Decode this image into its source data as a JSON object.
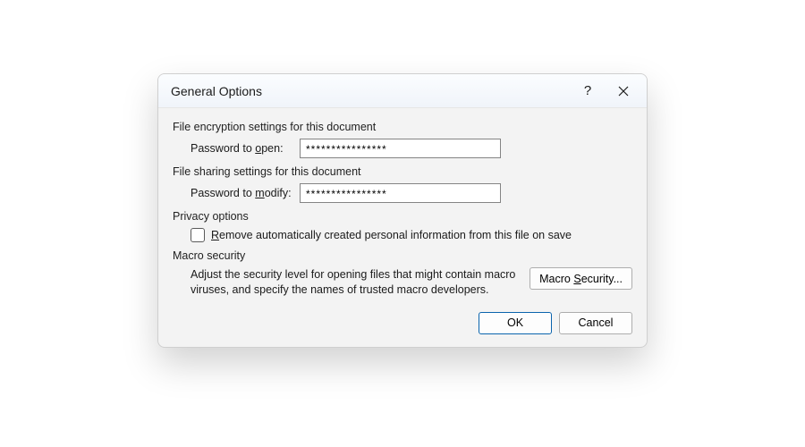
{
  "titlebar": {
    "title": "General Options",
    "help_symbol": "?"
  },
  "encryption": {
    "group_label": "File encryption settings for this document",
    "password_open_prefix": "Password to ",
    "password_open_key": "o",
    "password_open_suffix": "pen:",
    "password_open_value": "****************"
  },
  "sharing": {
    "group_label": "File sharing settings for this document",
    "password_modify_prefix": "Password to ",
    "password_modify_key": "m",
    "password_modify_suffix": "odify:",
    "password_modify_value": "****************"
  },
  "privacy": {
    "group_label": "Privacy options",
    "checkbox_checked": false,
    "label_key": "R",
    "label_rest": "emove automatically created personal information from this file on save"
  },
  "macro": {
    "group_label": "Macro security",
    "description": "Adjust the security level for opening files that might contain macro viruses, and specify the names of trusted macro developers.",
    "button_prefix": "Macro ",
    "button_key": "S",
    "button_suffix": "ecurity..."
  },
  "footer": {
    "ok": "OK",
    "cancel": "Cancel"
  }
}
